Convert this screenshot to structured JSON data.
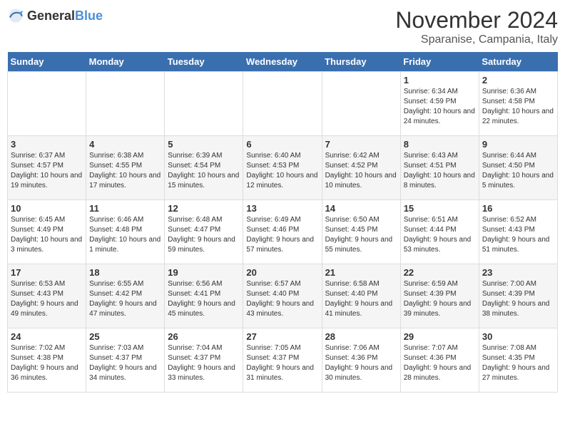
{
  "logo": {
    "text_general": "General",
    "text_blue": "Blue"
  },
  "title": "November 2024",
  "subtitle": "Sparanise, Campania, Italy",
  "days_of_week": [
    "Sunday",
    "Monday",
    "Tuesday",
    "Wednesday",
    "Thursday",
    "Friday",
    "Saturday"
  ],
  "weeks": [
    [
      {
        "day": "",
        "info": ""
      },
      {
        "day": "",
        "info": ""
      },
      {
        "day": "",
        "info": ""
      },
      {
        "day": "",
        "info": ""
      },
      {
        "day": "",
        "info": ""
      },
      {
        "day": "1",
        "info": "Sunrise: 6:34 AM\nSunset: 4:59 PM\nDaylight: 10 hours and 24 minutes."
      },
      {
        "day": "2",
        "info": "Sunrise: 6:36 AM\nSunset: 4:58 PM\nDaylight: 10 hours and 22 minutes."
      }
    ],
    [
      {
        "day": "3",
        "info": "Sunrise: 6:37 AM\nSunset: 4:57 PM\nDaylight: 10 hours and 19 minutes."
      },
      {
        "day": "4",
        "info": "Sunrise: 6:38 AM\nSunset: 4:55 PM\nDaylight: 10 hours and 17 minutes."
      },
      {
        "day": "5",
        "info": "Sunrise: 6:39 AM\nSunset: 4:54 PM\nDaylight: 10 hours and 15 minutes."
      },
      {
        "day": "6",
        "info": "Sunrise: 6:40 AM\nSunset: 4:53 PM\nDaylight: 10 hours and 12 minutes."
      },
      {
        "day": "7",
        "info": "Sunrise: 6:42 AM\nSunset: 4:52 PM\nDaylight: 10 hours and 10 minutes."
      },
      {
        "day": "8",
        "info": "Sunrise: 6:43 AM\nSunset: 4:51 PM\nDaylight: 10 hours and 8 minutes."
      },
      {
        "day": "9",
        "info": "Sunrise: 6:44 AM\nSunset: 4:50 PM\nDaylight: 10 hours and 5 minutes."
      }
    ],
    [
      {
        "day": "10",
        "info": "Sunrise: 6:45 AM\nSunset: 4:49 PM\nDaylight: 10 hours and 3 minutes."
      },
      {
        "day": "11",
        "info": "Sunrise: 6:46 AM\nSunset: 4:48 PM\nDaylight: 10 hours and 1 minute."
      },
      {
        "day": "12",
        "info": "Sunrise: 6:48 AM\nSunset: 4:47 PM\nDaylight: 9 hours and 59 minutes."
      },
      {
        "day": "13",
        "info": "Sunrise: 6:49 AM\nSunset: 4:46 PM\nDaylight: 9 hours and 57 minutes."
      },
      {
        "day": "14",
        "info": "Sunrise: 6:50 AM\nSunset: 4:45 PM\nDaylight: 9 hours and 55 minutes."
      },
      {
        "day": "15",
        "info": "Sunrise: 6:51 AM\nSunset: 4:44 PM\nDaylight: 9 hours and 53 minutes."
      },
      {
        "day": "16",
        "info": "Sunrise: 6:52 AM\nSunset: 4:43 PM\nDaylight: 9 hours and 51 minutes."
      }
    ],
    [
      {
        "day": "17",
        "info": "Sunrise: 6:53 AM\nSunset: 4:43 PM\nDaylight: 9 hours and 49 minutes."
      },
      {
        "day": "18",
        "info": "Sunrise: 6:55 AM\nSunset: 4:42 PM\nDaylight: 9 hours and 47 minutes."
      },
      {
        "day": "19",
        "info": "Sunrise: 6:56 AM\nSunset: 4:41 PM\nDaylight: 9 hours and 45 minutes."
      },
      {
        "day": "20",
        "info": "Sunrise: 6:57 AM\nSunset: 4:40 PM\nDaylight: 9 hours and 43 minutes."
      },
      {
        "day": "21",
        "info": "Sunrise: 6:58 AM\nSunset: 4:40 PM\nDaylight: 9 hours and 41 minutes."
      },
      {
        "day": "22",
        "info": "Sunrise: 6:59 AM\nSunset: 4:39 PM\nDaylight: 9 hours and 39 minutes."
      },
      {
        "day": "23",
        "info": "Sunrise: 7:00 AM\nSunset: 4:39 PM\nDaylight: 9 hours and 38 minutes."
      }
    ],
    [
      {
        "day": "24",
        "info": "Sunrise: 7:02 AM\nSunset: 4:38 PM\nDaylight: 9 hours and 36 minutes."
      },
      {
        "day": "25",
        "info": "Sunrise: 7:03 AM\nSunset: 4:37 PM\nDaylight: 9 hours and 34 minutes."
      },
      {
        "day": "26",
        "info": "Sunrise: 7:04 AM\nSunset: 4:37 PM\nDaylight: 9 hours and 33 minutes."
      },
      {
        "day": "27",
        "info": "Sunrise: 7:05 AM\nSunset: 4:37 PM\nDaylight: 9 hours and 31 minutes."
      },
      {
        "day": "28",
        "info": "Sunrise: 7:06 AM\nSunset: 4:36 PM\nDaylight: 9 hours and 30 minutes."
      },
      {
        "day": "29",
        "info": "Sunrise: 7:07 AM\nSunset: 4:36 PM\nDaylight: 9 hours and 28 minutes."
      },
      {
        "day": "30",
        "info": "Sunrise: 7:08 AM\nSunset: 4:35 PM\nDaylight: 9 hours and 27 minutes."
      }
    ]
  ]
}
